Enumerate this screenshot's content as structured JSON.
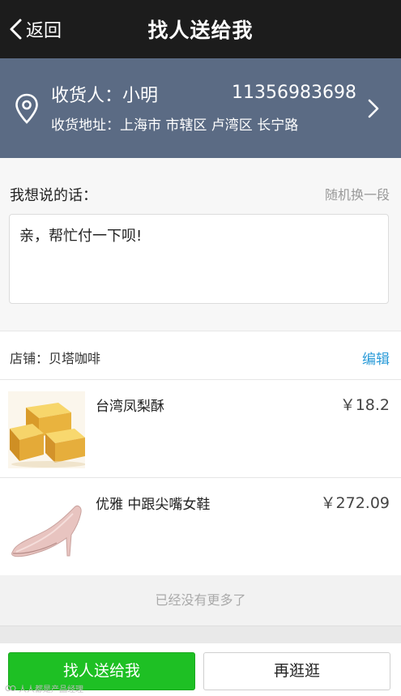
{
  "navbar": {
    "back_label": "返回",
    "title": "找人送给我"
  },
  "address": {
    "recipient_label": "收货人：",
    "recipient_name": "小明",
    "phone": "11356983698",
    "address_label": "收货地址：",
    "address_value": "上海市 市辖区 卢湾区 长宁路"
  },
  "message": {
    "label": "我想说的话：",
    "random_label": "随机换一段",
    "text": "亲，帮忙付一下呗!"
  },
  "shop": {
    "label": "店铺：",
    "name": "贝塔咖啡",
    "edit_label": "编辑",
    "items": [
      {
        "name": "台湾凤梨酥",
        "price": "￥18.2"
      },
      {
        "name": "优雅 中跟尖嘴女鞋",
        "price": "￥272.09"
      }
    ]
  },
  "list_end_text": "已经没有更多了",
  "buttons": {
    "primary": "找人送给我",
    "secondary": "再逛逛"
  },
  "watermark": "人人都是产品经理",
  "colors": {
    "navbar": "#1c1c1c",
    "address_bg": "#5b6b84",
    "accent_green": "#1ec024",
    "link_blue": "#2a9bd8"
  }
}
